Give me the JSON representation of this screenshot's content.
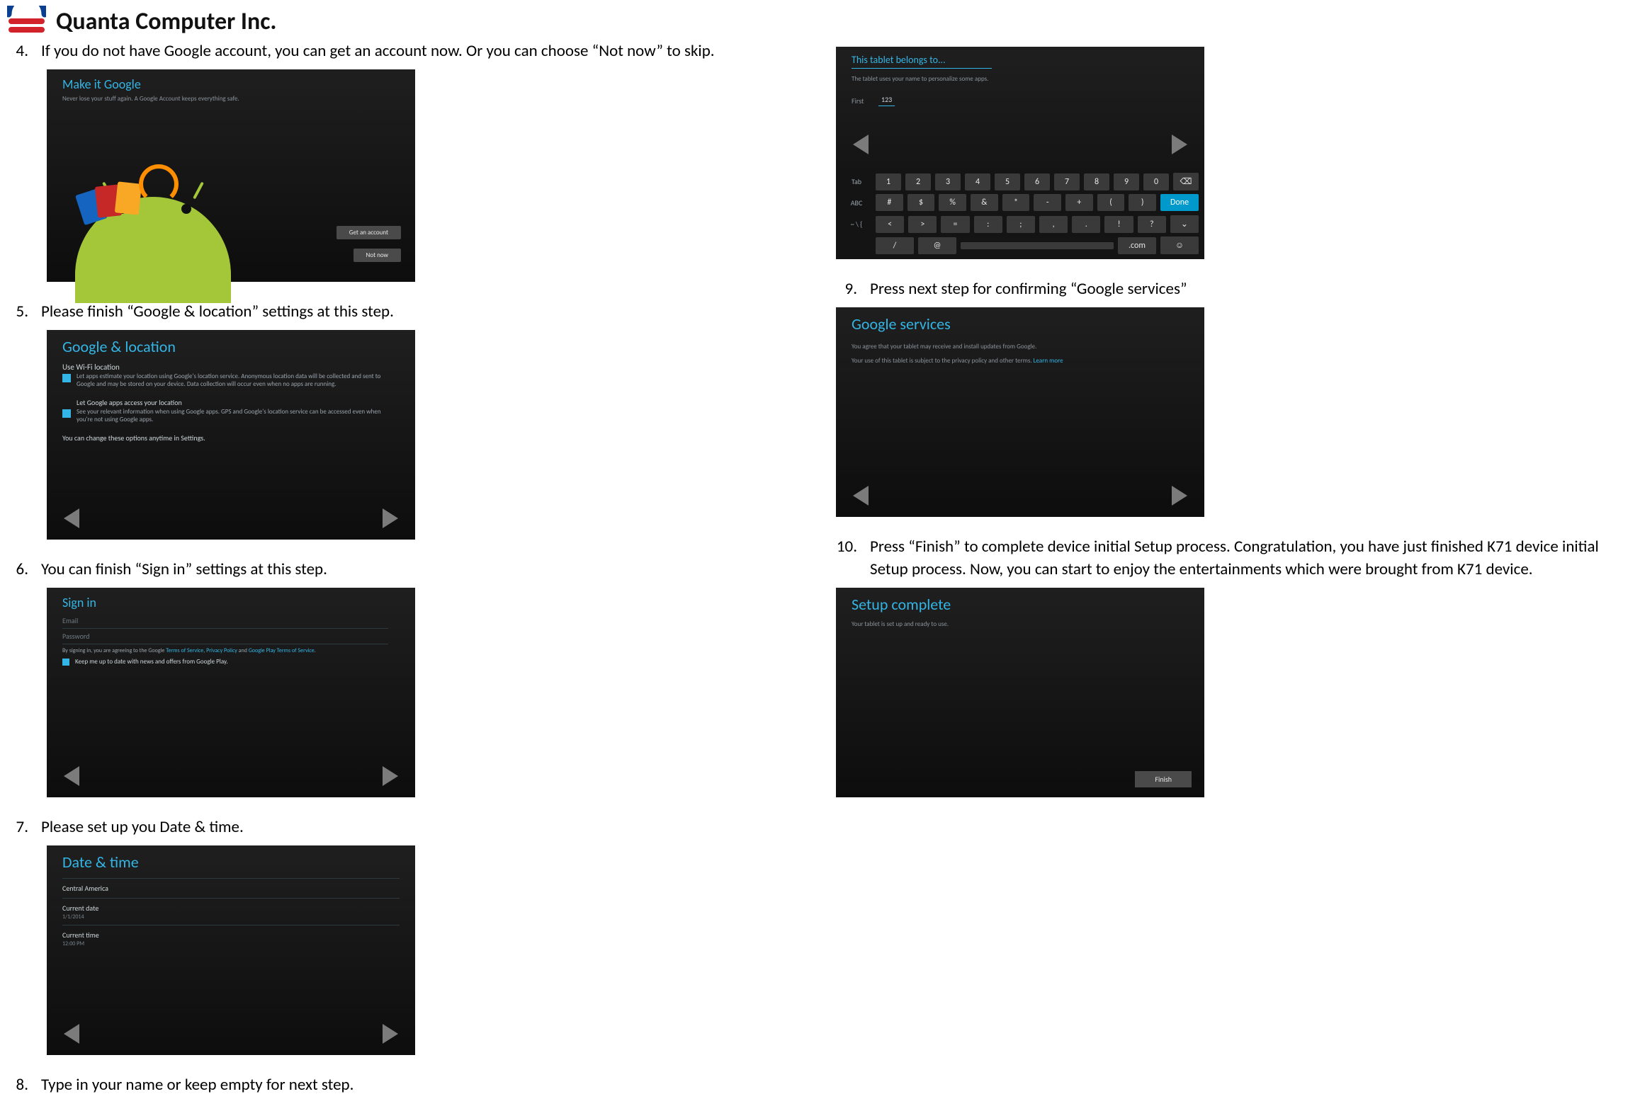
{
  "header": {
    "company": "Quanta Computer Inc."
  },
  "colors": {
    "accent": "#33b5e5",
    "android_green": "#a4c639",
    "done_blue": "#0099cc"
  },
  "left_steps": [
    {
      "n": "4.",
      "text": "If you do not have Google account, you can get an account now. Or you can choose “Not now” to skip."
    },
    {
      "n": "5.",
      "text": "Please finish “Google & location” settings at this step."
    },
    {
      "n": "6.",
      "text": "You can finish “Sign in” settings at this step."
    },
    {
      "n": "7.",
      "text": "Please set up you Date & time."
    },
    {
      "n": "8.",
      "text": "Type in your name or keep empty for next step."
    }
  ],
  "right_steps": [
    {
      "n": "9.",
      "text": "Press next step for confirming “Google services”"
    },
    {
      "n": "10.",
      "text": "Press “Finish” to complete device initial Setup process. Congratulation, you have just finished K71 device initial Setup process. Now, you can start to enjoy the entertainments which were brought from K71 device."
    }
  ],
  "shot4": {
    "title": "Make it Google",
    "subtitle": "Never lose your stuff again. A Google Account keeps everything safe.",
    "btn_get": "Get an account",
    "btn_not": "Not now"
  },
  "shot5": {
    "title": "Google & location",
    "use_wifi": "Use Wi-Fi location",
    "row1": "Let apps estimate your location using Google's location service. Anonymous location data will be collected and sent to Google and may be stored on your device. Data collection will occur even when no apps are running.",
    "row2_t": "Let Google apps access your location",
    "row2": "See your relevant information when using Google apps. GPS and Google's location service can be accessed even when you're not using Google apps.",
    "hint": "You can change these options anytime in Settings."
  },
  "shot6": {
    "title": "Sign in",
    "email": "Email",
    "password": "Password",
    "legal_pre": "By signing in, you are agreeing to the Google ",
    "tos": "Terms of Service",
    "legal_mid": ", ",
    "pp": "Privacy Policy",
    "legal_mid2": " and ",
    "play": "Google Play Terms of Service",
    "legal_end": ".",
    "keep": "Keep me up to date with news and offers from Google Play."
  },
  "shot7": {
    "title": "Date & time",
    "tz": "Central America",
    "d_label": "Current date",
    "d_val": "1/1/2014",
    "t_label": "Current time",
    "t_val": "12:00 PM"
  },
  "shot8": {
    "title": "This tablet belongs to...",
    "subtitle": "The tablet uses your name to personalize some apps.",
    "first_label": "First",
    "first_value": "123"
  },
  "kb": {
    "rows": [
      {
        "side": "Tab",
        "keys": [
          "1",
          "2",
          "3",
          "4",
          "5",
          "6",
          "7",
          "8",
          "9",
          "0"
        ]
      },
      {
        "side": "ABC",
        "keys": [
          "#",
          "$",
          "%",
          "&",
          "*",
          "-",
          "+",
          "(",
          ")"
        ],
        "tail": "Done"
      },
      {
        "side": "~ \\ {",
        "keys": [
          "<",
          ">",
          "=",
          ":",
          ";",
          ",",
          ".",
          "!",
          "?"
        ]
      },
      {
        "side": "",
        "keys": [
          "/",
          "@",
          "",
          ".com"
        ]
      }
    ]
  },
  "shot9": {
    "title": "Google services",
    "line1": "You agree that your tablet may receive and install updates from Google.",
    "line2_pre": "Your use of this tablet is subject to the privacy policy and other terms. ",
    "learn": "Learn more"
  },
  "shot10": {
    "title": "Setup complete",
    "subtitle": "Your tablet is set up and ready to use.",
    "finish": "Finish"
  }
}
